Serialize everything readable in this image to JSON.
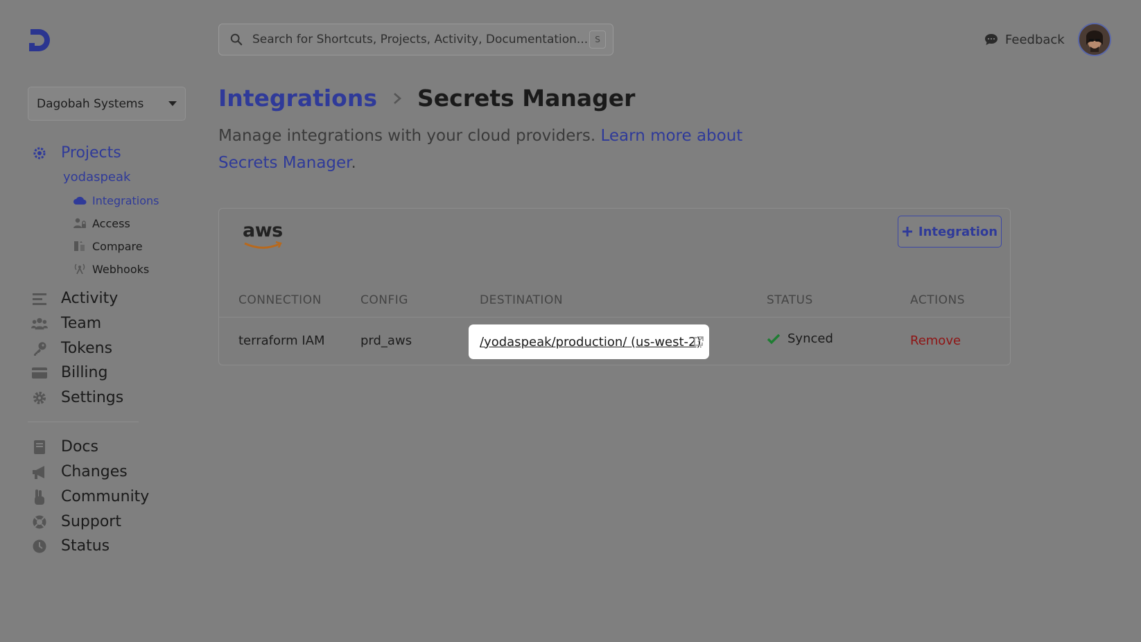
{
  "header": {
    "logo_icon": "doppler-logo-icon",
    "search_placeholder": "Search for Shortcuts, Projects, Activity, Documentation...",
    "search_shortcut": "S",
    "feedback_label": "Feedback",
    "feedback_icon": "chat-bubble-icon"
  },
  "sidebar": {
    "workspace": "Dagobah Systems",
    "projects_label": "Projects",
    "project_name": "yodaspeak",
    "project_items": [
      {
        "label": "Integrations",
        "icon": "cloud-icon"
      },
      {
        "label": "Access",
        "icon": "users-lock-icon"
      },
      {
        "label": "Compare",
        "icon": "compare-icon"
      },
      {
        "label": "Webhooks",
        "icon": "broadcast-icon"
      }
    ],
    "main_items": [
      {
        "label": "Activity",
        "icon": "list-icon"
      },
      {
        "label": "Team",
        "icon": "team-icon"
      },
      {
        "label": "Tokens",
        "icon": "key-icon"
      },
      {
        "label": "Billing",
        "icon": "credit-card-icon"
      },
      {
        "label": "Settings",
        "icon": "gear-icon"
      }
    ],
    "resource_items": [
      {
        "label": "Docs",
        "icon": "book-icon"
      },
      {
        "label": "Changes",
        "icon": "megaphone-icon"
      },
      {
        "label": "Community",
        "icon": "hand-peace-icon"
      },
      {
        "label": "Support",
        "icon": "lifebuoy-icon"
      },
      {
        "label": "Status",
        "icon": "clock-icon"
      }
    ]
  },
  "page": {
    "breadcrumb_parent": "Integrations",
    "title": "Secrets Manager",
    "subtitle_text": "Manage integrations with your cloud providers. ",
    "subtitle_link": "Learn more about Secrets Manager",
    "subtitle_end": "."
  },
  "card": {
    "provider": "aws",
    "add_button": "Integration",
    "columns": [
      "CONNECTION",
      "CONFIG",
      "DESTINATION",
      "STATUS",
      "ACTIONS"
    ],
    "rows": [
      {
        "connection": "terraform IAM",
        "config": "prd_aws",
        "destination": "/yodaspeak/production/ (us-west-2)",
        "status": "Synced",
        "action": "Remove"
      }
    ]
  },
  "colors": {
    "accent": "#2f3a99",
    "danger": "#8f1414",
    "success": "#1e7d32",
    "overlay_bg": "#7f7f7f"
  }
}
